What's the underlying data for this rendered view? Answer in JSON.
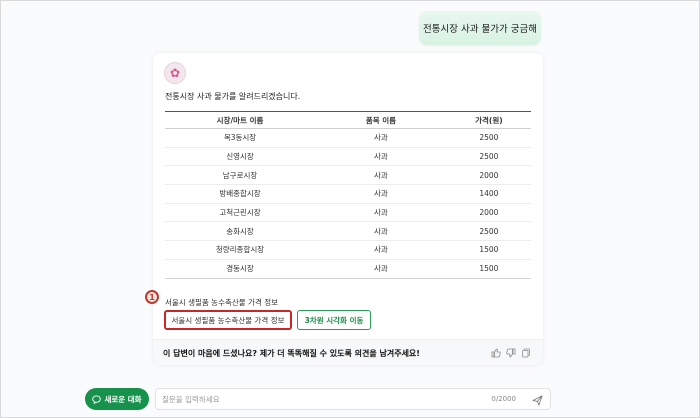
{
  "user_message": "전통시장 사과 물가가 궁금해",
  "answer": {
    "intro": "전통시장 사과 물가를 알려드리겠습니다.",
    "table": {
      "headers": [
        "시장/마트 이름",
        "품목 이름",
        "가격(원)"
      ],
      "rows": [
        [
          "목3동시장",
          "사과",
          "2500"
        ],
        [
          "신영시장",
          "사과",
          "2500"
        ],
        [
          "남구로시장",
          "사과",
          "2000"
        ],
        [
          "방배종합시장",
          "사과",
          "1400"
        ],
        [
          "고척근린시장",
          "사과",
          "2000"
        ],
        [
          "송화시장",
          "사과",
          "2500"
        ],
        [
          "청량리종합시장",
          "사과",
          "1500"
        ],
        [
          "경동시장",
          "사과",
          "1500"
        ]
      ]
    },
    "source_label": "서울시 생필품 농수축산물 가격 정보",
    "source_button": "서울시 생필품 농수축산물 가격 정보",
    "viz_button": "3차원 시각화 이동",
    "marker": "1"
  },
  "feedback": {
    "prompt": "이 답변이 마음에 드셨나요? 제가 더 똑똑해질 수 있도록 의견을 남겨주세요!"
  },
  "composer": {
    "new_chat": "새로운 대화",
    "placeholder": "질문을 입력하세요",
    "counter": "0/2000"
  },
  "colors": {
    "accent": "#17924d",
    "highlight": "#c62828"
  },
  "icons": [
    "avatar-icon",
    "thumbs-up-icon",
    "thumbs-down-icon",
    "copy-icon",
    "chat-icon",
    "send-icon"
  ]
}
